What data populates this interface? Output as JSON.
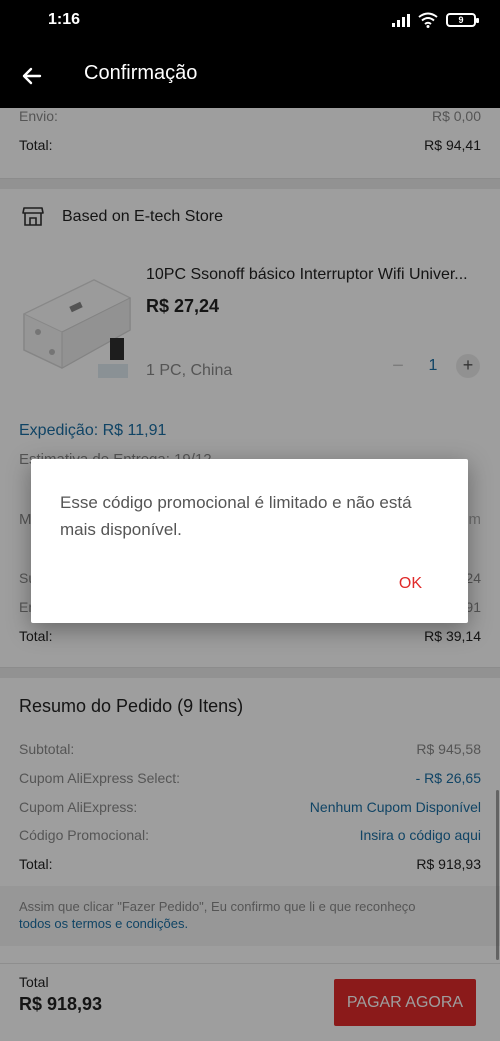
{
  "status_bar": {
    "time": "1:16",
    "battery": "9"
  },
  "app_bar": {
    "title": "Confirmação"
  },
  "seller1": {
    "shipping_label": "Envio:",
    "shipping_value": "R$ 0,00",
    "total_label": "Total:",
    "total_value": "R$ 94,41"
  },
  "store": {
    "name": "Based on E-tech Store",
    "product": {
      "title": "10PC Ssonoff básico Interruptor Wifi Univer...",
      "price": "R$ 27,24",
      "variant": "1 PC, China",
      "quantity": "1",
      "minus": "−",
      "plus": "+"
    },
    "shipping": "Expedição: R$ 11,91",
    "estimate_label": "Estimativa de Entrega:",
    "estimate_value": "19/12",
    "message_peek": "M",
    "message_peek_right": "m",
    "subtotal_peek_left": "Su",
    "subtotal_peek_right": "24",
    "shipping_peek_left": "En",
    "shipping_peek_right": "91",
    "total_label": "Total:",
    "total_value": "R$ 39,14"
  },
  "summary": {
    "title": "Resumo do Pedido (9 Itens)",
    "rows": [
      {
        "label": "Subtotal:",
        "value": "R$ 945,58"
      },
      {
        "label": "Cupom AliExpress Select:",
        "value": "- R$ 26,65"
      },
      {
        "label": "Cupom AliExpress:",
        "value": "Nenhum Cupom Disponível"
      },
      {
        "label": "Código Promocional:",
        "value": "Insira o código aqui"
      },
      {
        "label": "Total:",
        "value": "R$ 918,93"
      }
    ],
    "legal_text": "Assim que clicar \"Fazer Pedido\", Eu confirmo que li e que reconheço",
    "legal_link": "todos os termos e condições."
  },
  "bottom_bar": {
    "total_label": "Total",
    "total_value": "R$ 918,93",
    "pay_button": "PAGAR AGORA"
  },
  "dialog": {
    "message": "Esse código promocional é limitado e não está mais disponível.",
    "ok_label": "OK"
  },
  "colors": {
    "accent_red": "#e02a2a",
    "link_blue": "#1b6fa3",
    "app_bar_bg": "#000000"
  }
}
